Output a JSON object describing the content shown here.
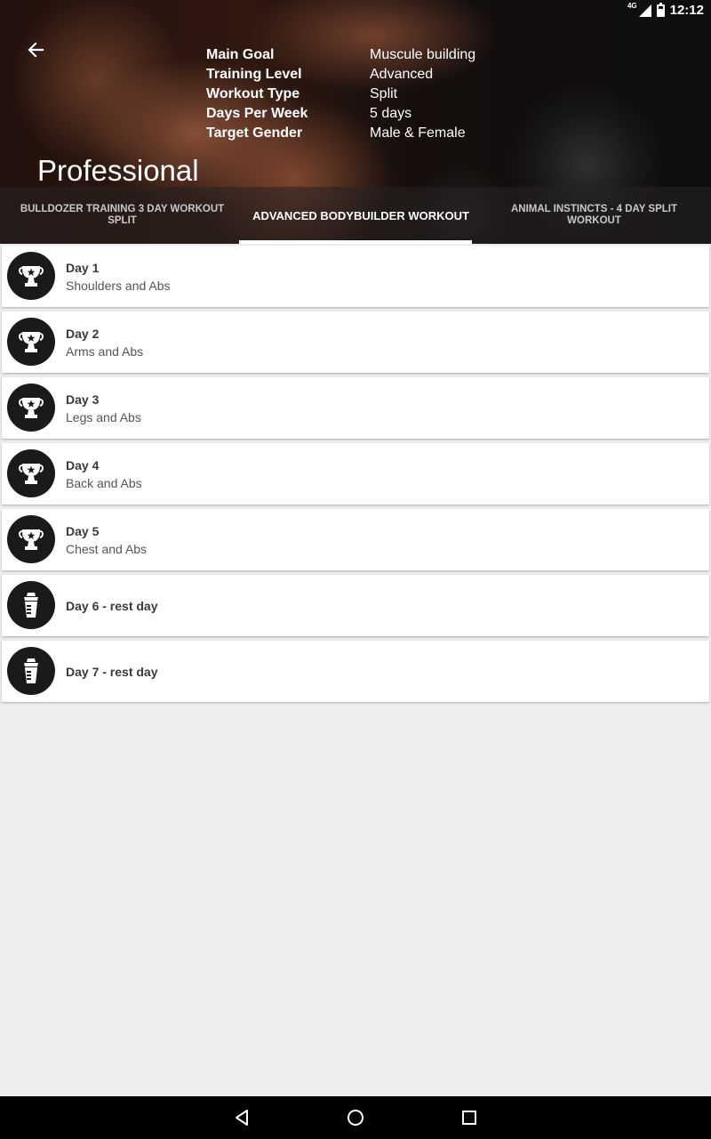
{
  "status_bar": {
    "network": "4G",
    "time": "12:12"
  },
  "header": {
    "back_icon": "arrow-left-icon",
    "title": "Professional",
    "info": [
      {
        "key": "Main Goal",
        "value": "Muscule building"
      },
      {
        "key": "Training Level",
        "value": "Advanced"
      },
      {
        "key": "Workout Type",
        "value": "Split"
      },
      {
        "key": "Days Per Week",
        "value": "5 days"
      },
      {
        "key": "Target Gender",
        "value": "Male & Female"
      }
    ]
  },
  "tabs": [
    {
      "label": "BULLDOZER TRAINING 3 DAY WORKOUT SPLIT",
      "selected": false
    },
    {
      "label": "ADVANCED BODYBUILDER WORKOUT",
      "selected": true
    },
    {
      "label": "ANIMAL INSTINCTS -  4 DAY SPLIT WORKOUT",
      "selected": false
    }
  ],
  "days": [
    {
      "title": "Day 1",
      "subtitle": "Shoulders and Abs",
      "icon": "trophy-icon"
    },
    {
      "title": "Day 2",
      "subtitle": "Arms and Abs",
      "icon": "trophy-icon"
    },
    {
      "title": "Day 3",
      "subtitle": "Legs and Abs",
      "icon": "trophy-icon"
    },
    {
      "title": "Day 4",
      "subtitle": "Back and Abs",
      "icon": "trophy-icon"
    },
    {
      "title": "Day 5",
      "subtitle": "Chest and Abs",
      "icon": "trophy-icon"
    },
    {
      "title": "Day 6 - rest day",
      "subtitle": "",
      "icon": "shaker-icon"
    },
    {
      "title": "Day 7 - rest day",
      "subtitle": "",
      "icon": "shaker-icon"
    }
  ],
  "nav": {
    "back": "back-triangle-icon",
    "home": "home-circle-icon",
    "recents": "recents-square-icon"
  }
}
